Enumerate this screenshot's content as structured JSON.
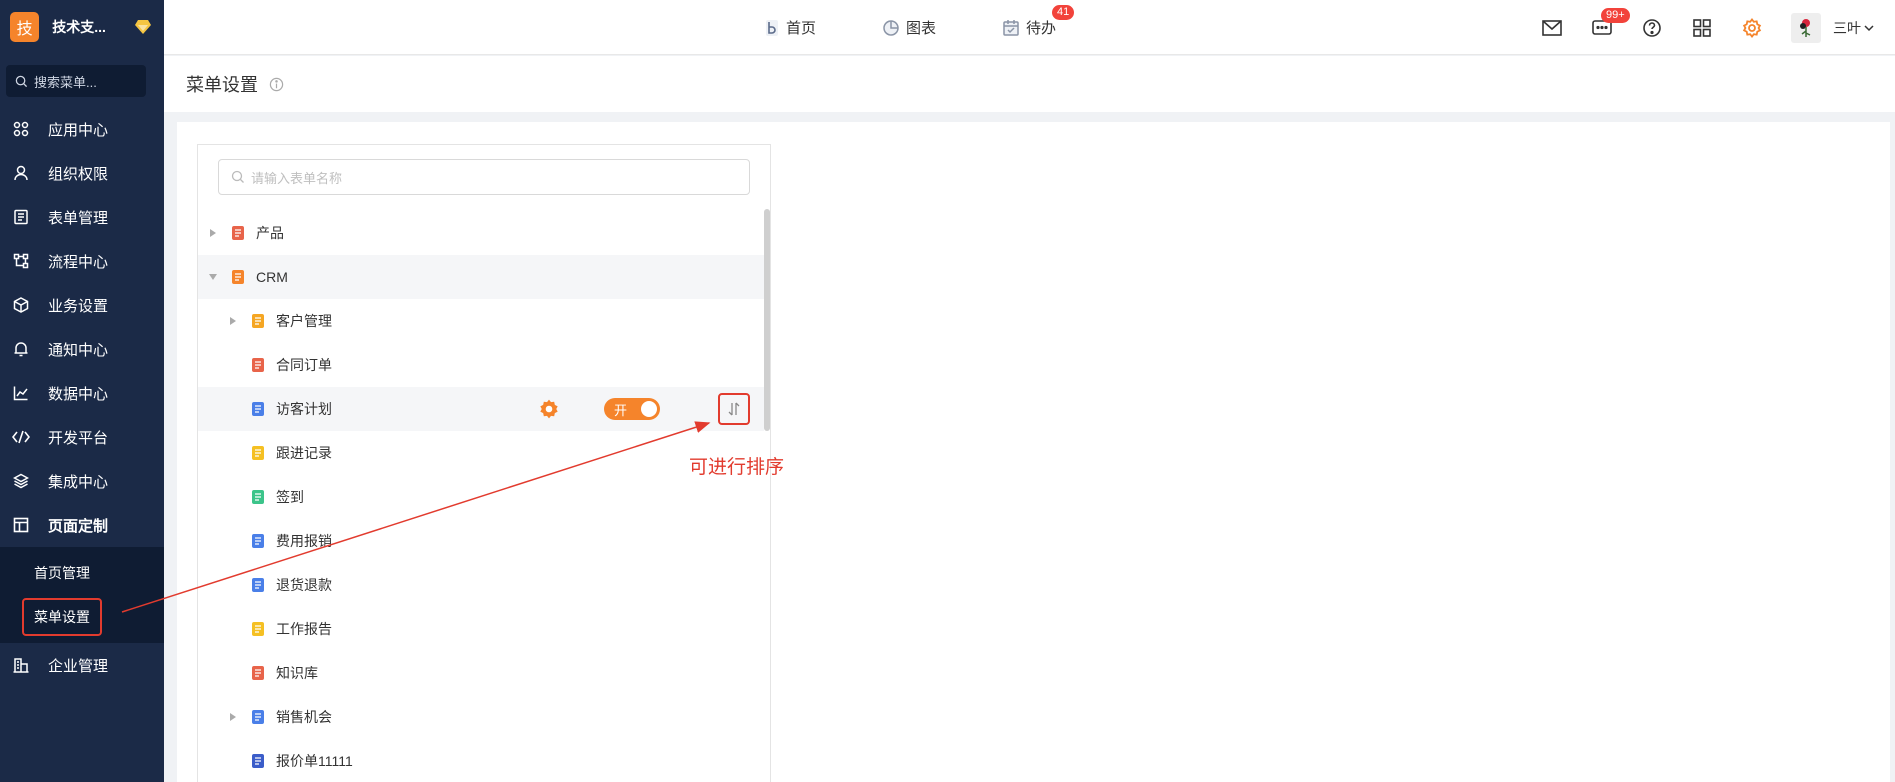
{
  "brand": {
    "logo_char": "技",
    "name": "技术支..."
  },
  "sidebar": {
    "search_placeholder": "搜索菜单...",
    "items": [
      {
        "label": "应用中心",
        "icon": "apps-icon"
      },
      {
        "label": "组织权限",
        "icon": "user-icon"
      },
      {
        "label": "表单管理",
        "icon": "form-icon"
      },
      {
        "label": "流程中心",
        "icon": "flow-icon"
      },
      {
        "label": "业务设置",
        "icon": "cube-icon"
      },
      {
        "label": "通知中心",
        "icon": "bell-icon"
      },
      {
        "label": "数据中心",
        "icon": "chart-icon"
      },
      {
        "label": "开发平台",
        "icon": "code-icon"
      },
      {
        "label": "集成中心",
        "icon": "layers-icon"
      },
      {
        "label": "页面定制",
        "icon": "layout-icon"
      }
    ],
    "submenu": [
      {
        "label": "首页管理"
      },
      {
        "label": "菜单设置"
      }
    ],
    "bottom_item": {
      "label": "企业管理",
      "icon": "building-icon"
    }
  },
  "header": {
    "nav": [
      {
        "label": "首页",
        "icon": "home-icon"
      },
      {
        "label": "图表",
        "icon": "pie-icon"
      },
      {
        "label": "待办",
        "icon": "calendar-icon",
        "badge": "41"
      }
    ],
    "message_badge": "99+",
    "user_name": "三叶"
  },
  "page": {
    "title": "菜单设置"
  },
  "tree": {
    "search_placeholder": "请输入表单名称",
    "rows": [
      {
        "label": "产品",
        "level": 0,
        "caret": "right",
        "icon_color": "#e8644a"
      },
      {
        "label": "CRM",
        "level": 0,
        "caret": "down",
        "icon_color": "#f5842b"
      },
      {
        "label": "客户管理",
        "level": 1,
        "caret": "right",
        "icon_color": "#f5a623"
      },
      {
        "label": "合同订单",
        "level": 1,
        "caret": "",
        "icon_color": "#e8644a"
      },
      {
        "label": "访客计划",
        "level": 1,
        "caret": "",
        "icon_color": "#4a7fe8"
      },
      {
        "label": "跟进记录",
        "level": 1,
        "caret": "",
        "icon_color": "#f5c023"
      },
      {
        "label": "签到",
        "level": 1,
        "caret": "",
        "icon_color": "#3cc48a"
      },
      {
        "label": "费用报销",
        "level": 1,
        "caret": "",
        "icon_color": "#4a7fe8"
      },
      {
        "label": "退货退款",
        "level": 1,
        "caret": "",
        "icon_color": "#4a7fe8"
      },
      {
        "label": "工作报告",
        "level": 1,
        "caret": "",
        "icon_color": "#f5c023"
      },
      {
        "label": "知识库",
        "level": 1,
        "caret": "",
        "icon_color": "#e8644a"
      },
      {
        "label": "销售机会",
        "level": 1,
        "caret": "right",
        "icon_color": "#4a7fe8"
      },
      {
        "label": "报价单11111",
        "level": 1,
        "caret": "",
        "icon_color": "#3b5dc9"
      }
    ],
    "toggle_label": "开"
  },
  "annotation": {
    "text": "可进行排序"
  },
  "colors": {
    "accent": "#f5842b",
    "sidebar_bg": "#1b2a47",
    "highlight_red": "#e23b2e"
  }
}
